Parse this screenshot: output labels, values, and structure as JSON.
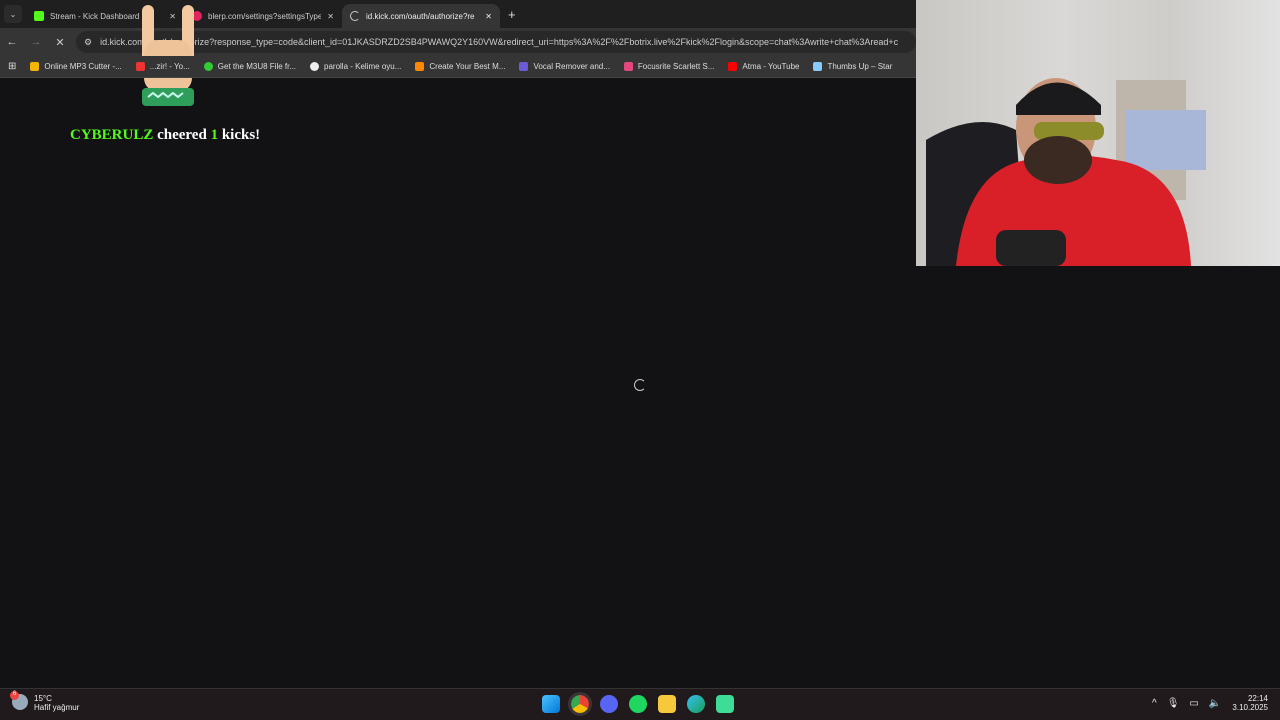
{
  "tabs": [
    {
      "title": "Stream - Kick Dashboard",
      "favicon": "kick-icon",
      "color": "#53fc18"
    },
    {
      "title": "blerp.com/settings?settingsType",
      "favicon": "blerp-icon",
      "color": "#e0245e"
    },
    {
      "title": "id.kick.com/oauth/authorize?re",
      "favicon": "loading-spinner-icon",
      "active": true
    }
  ],
  "address": {
    "url": "id.kick.com/oauth/authorize?response_type=code&client_id=01JKASDRZD2SB4PWAWQ2Y160VW&redirect_uri=https%3A%2F%2Fbotrix.live%2Fkick%2Flogin&scope=chat%3Awrite+chat%3Aread+c"
  },
  "bookmarks": [
    {
      "label": "Online MP3 Cutter -...",
      "color": "#f4b400"
    },
    {
      "label": "...zir! - Yo...",
      "color": "#e33"
    },
    {
      "label": "Get the M3U8 File fr...",
      "color": "#3c3"
    },
    {
      "label": "parolla - Kelime oyu...",
      "color": "#eee"
    },
    {
      "label": "Create Your Best M...",
      "color": "#f80"
    },
    {
      "label": "Vocal Remover and...",
      "color": "#6b5bd6"
    },
    {
      "label": "Focusrite Scarlett S...",
      "color": "#e4477d"
    },
    {
      "label": "Atma - YouTube",
      "color": "#f00"
    },
    {
      "label": "Thumbs Up – Star",
      "color": "#8cf"
    }
  ],
  "alert": {
    "user": "CYBERULZ",
    "verb": "cheered",
    "amount": "1",
    "suffix": "kicks!"
  },
  "taskbar": {
    "temp": "15°C",
    "weather": "Hafif yağmur",
    "time": "22:14",
    "date": "3.10.2025",
    "weather_badge": "6"
  }
}
